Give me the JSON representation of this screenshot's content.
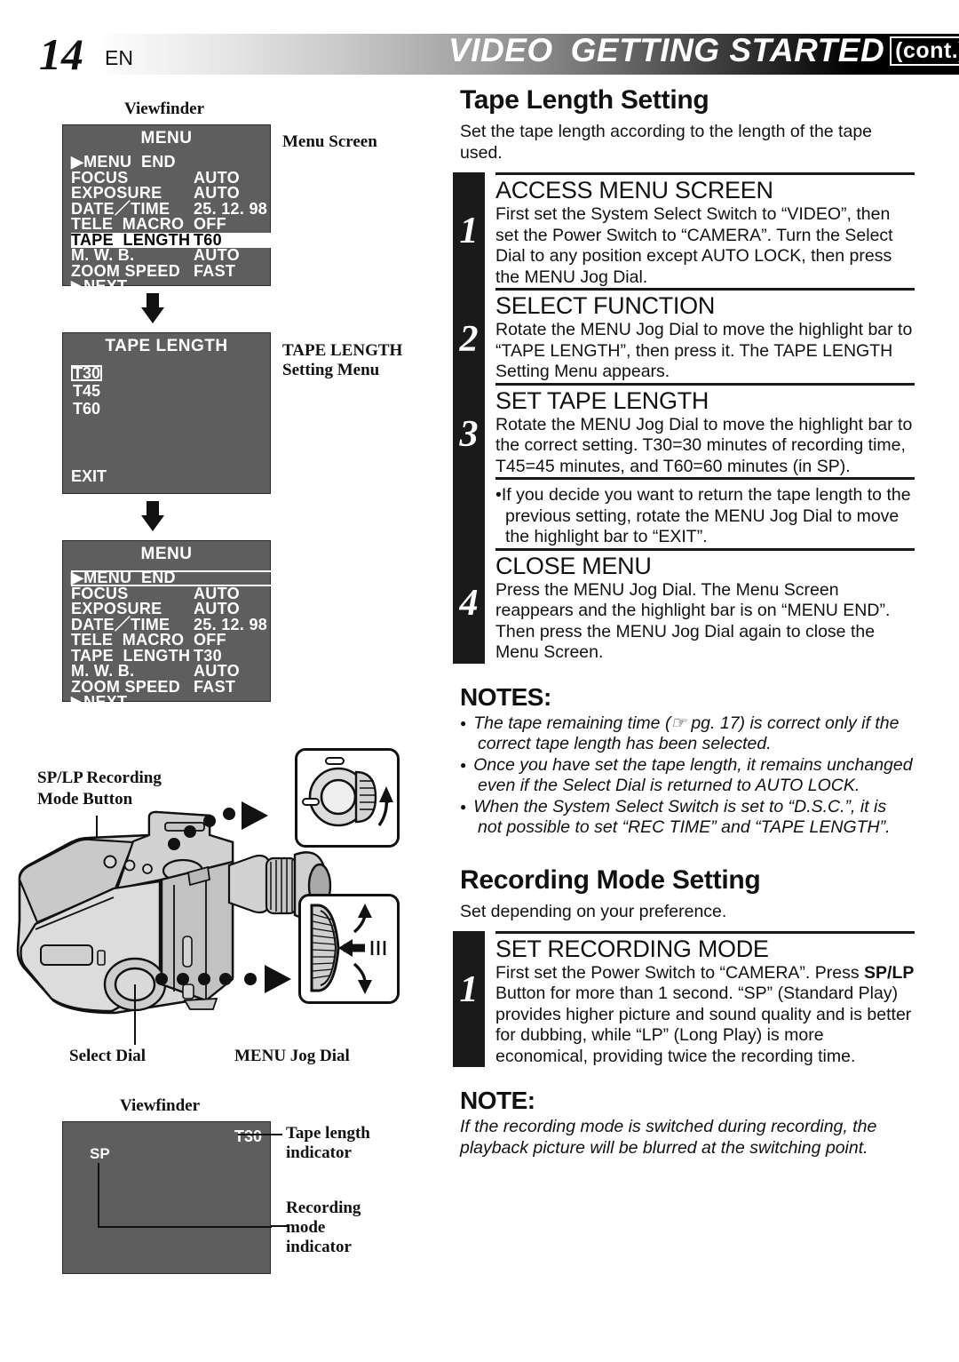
{
  "header": {
    "page_number": "14",
    "page_lang": "EN",
    "title_video": "VIDEO",
    "title_section": "GETTING STARTED",
    "continued": "(cont.)"
  },
  "left": {
    "viewfinder_label_top": "Viewfinder",
    "viewfinder_label_bottom": "Viewfinder",
    "menu_screen_label": "Menu Screen",
    "tape_length_menu_label_line1": "TAPE LENGTH",
    "tape_length_menu_label_line2": "Setting Menu",
    "menu_screen_1": {
      "title": "MENU",
      "rows": [
        {
          "label": "▶MENU  END",
          "value": "",
          "state": "normal"
        },
        {
          "label": "FOCUS",
          "value": "AUTO",
          "state": "normal"
        },
        {
          "label": "EXPOSURE",
          "value": "AUTO",
          "state": "normal"
        },
        {
          "label": "DATE／TIME",
          "value": "25. 12. 98",
          "state": "normal"
        },
        {
          "label": "TELE  MACRO",
          "value": "OFF",
          "state": "normal"
        },
        {
          "label": "TAPE  LENGTH",
          "value": "T60",
          "state": "highlight"
        },
        {
          "label": "M. W. B.",
          "value": "AUTO",
          "state": "normal"
        },
        {
          "label": "ZOOM SPEED",
          "value": "FAST",
          "state": "normal"
        },
        {
          "label": "▶NEXT",
          "value": "",
          "state": "normal"
        }
      ]
    },
    "tape_length_screen": {
      "title": "TAPE  LENGTH",
      "options": [
        {
          "label": "T30",
          "selected": true
        },
        {
          "label": "T45",
          "selected": false
        },
        {
          "label": "T60",
          "selected": false
        }
      ],
      "exit": "EXIT"
    },
    "menu_screen_2": {
      "title": "MENU",
      "rows": [
        {
          "label": "▶MENU  END",
          "value": "",
          "state": "outline"
        },
        {
          "label": "FOCUS",
          "value": "AUTO",
          "state": "normal"
        },
        {
          "label": "EXPOSURE",
          "value": "AUTO",
          "state": "normal"
        },
        {
          "label": "DATE／TIME",
          "value": "25. 12. 98",
          "state": "normal"
        },
        {
          "label": "TELE  MACRO",
          "value": "OFF",
          "state": "normal"
        },
        {
          "label": "TAPE  LENGTH",
          "value": "T30",
          "state": "normal"
        },
        {
          "label": "M. W. B.",
          "value": "AUTO",
          "state": "normal"
        },
        {
          "label": "ZOOM SPEED",
          "value": "FAST",
          "state": "normal"
        },
        {
          "label": "▶NEXT",
          "value": "",
          "state": "normal"
        }
      ]
    },
    "camera": {
      "sp_lp_label_line1": "SP/LP Recording",
      "sp_lp_label_line2": "Mode Button",
      "select_dial_label": "Select Dial",
      "menu_jog_dial_label": "MENU Jog Dial"
    },
    "viewfinder_bottom": {
      "tape_indicator_value": "T30",
      "recording_mode_value": "SP",
      "tape_indicator_label_line1": "Tape length",
      "tape_indicator_label_line2": "indicator",
      "recording_label_line1": "Recording",
      "recording_label_line2": "mode",
      "recording_label_line3": "indicator"
    }
  },
  "right": {
    "section1": {
      "heading": "Tape Length Setting",
      "intro": "Set the tape length according to the length of the tape used.",
      "steps": [
        {
          "number": "1",
          "title": "ACCESS MENU SCREEN",
          "body": "First set the System Select Switch to “VIDEO”, then set the Power Switch to “CAMERA”. Turn the Select Dial to any position except AUTO LOCK, then press the MENU Jog Dial."
        },
        {
          "number": "2",
          "title": "SELECT FUNCTION",
          "body": "Rotate the MENU Jog Dial to move the highlight bar to “TAPE LENGTH”, then press it. The TAPE LENGTH Setting Menu appears."
        },
        {
          "number": "3",
          "title": "SET TAPE LENGTH",
          "body": "Rotate the MENU Jog Dial to move the highlight bar to the correct setting. T30=30 minutes of recording time, T45=45 minutes, and T60=60 minutes (in SP)."
        }
      ],
      "sub_bullet": "•If  you decide you want to return the tape length to the previous setting, rotate the MENU Jog Dial to move the highlight bar to “EXIT”.",
      "step4": {
        "number": "4",
        "title": "CLOSE MENU",
        "body": "Press the MENU Jog Dial. The Menu Screen reappears and the highlight bar is on “MENU END”. Then press the MENU Jog Dial again to close the Menu Screen."
      },
      "notes_heading": "NOTES:",
      "notes": [
        "The tape remaining time (☞ pg. 17) is correct only if the correct tape length has been selected.",
        "Once you have set the tape length, it remains unchanged even if the Select Dial is returned to AUTO LOCK.",
        "When the System Select Switch is set to “D.S.C.”, it is not possible to set “REC TIME” and “TAPE LENGTH”."
      ]
    },
    "section2": {
      "heading": "Recording Mode Setting",
      "intro": "Set depending on your preference.",
      "step": {
        "number": "1",
        "title": "SET RECORDING MODE",
        "body_part1": "First set the Power Switch to “CAMERA”. Press ",
        "body_bold": "SP/LP",
        "body_part2": " Button for more than 1 second. “SP” (Standard Play) provides higher picture and sound quality and is better for dubbing, while “LP” (Long Play) is more economical, providing twice the recording time."
      },
      "note_heading": "NOTE:",
      "note_body": "If the recording mode is switched during recording, the playback picture will be blurred at the switching point."
    }
  }
}
